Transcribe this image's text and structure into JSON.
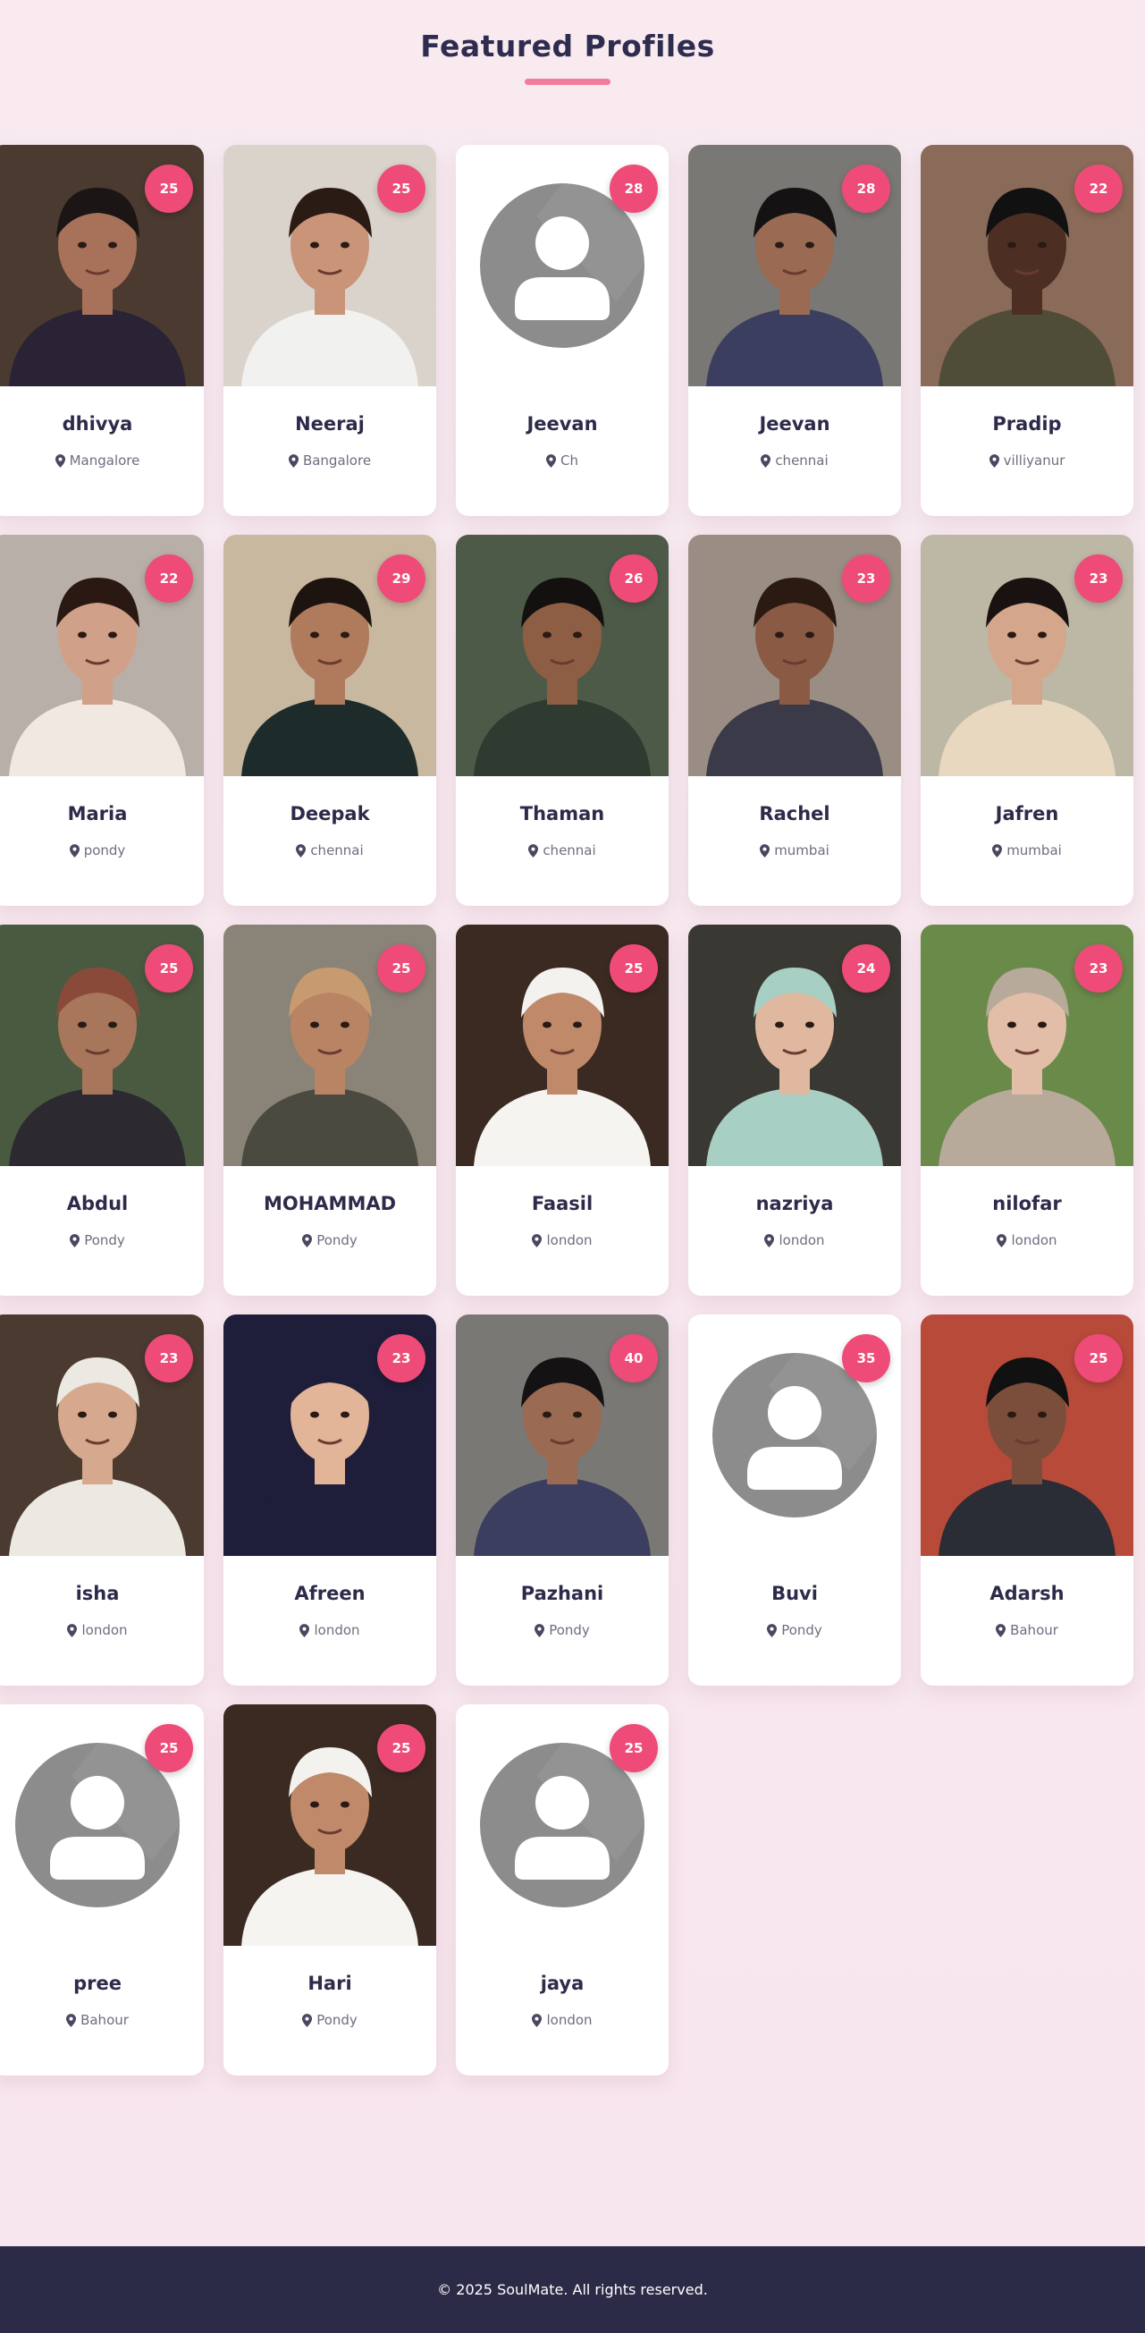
{
  "section_title": "Featured Profiles",
  "footer": {
    "copyright": "© 2025 SoulMate. All rights reserved."
  },
  "profiles": [
    {
      "name": "dhivya",
      "age": "25",
      "location": "Mangalore",
      "photo": "person",
      "skin": "#a8725a",
      "hair": "#1b1515",
      "shirt": "#2a2235",
      "bg": "#4a3a30"
    },
    {
      "name": "Neeraj",
      "age": "25",
      "location": "Bangalore",
      "photo": "person",
      "skin": "#c99478",
      "hair": "#2a1c14",
      "shirt": "#f1f1ef",
      "bg": "#d9d3cb"
    },
    {
      "name": "Jeevan",
      "age": "28",
      "location": "Ch",
      "photo": "placeholder"
    },
    {
      "name": "Jeevan",
      "age": "28",
      "location": "chennai",
      "photo": "person",
      "skin": "#9a6a52",
      "hair": "#141212",
      "shirt": "#3b3e5e",
      "bg": "#7a7874"
    },
    {
      "name": "Pradip",
      "age": "22",
      "location": "villiyanur",
      "photo": "person",
      "skin": "#4c2f22",
      "hair": "#111",
      "shirt": "#4f4d38",
      "bg": "#8a6a58"
    },
    {
      "name": "Maria",
      "age": "22",
      "location": "pondy",
      "photo": "person",
      "skin": "#d1a088",
      "hair": "#2a1812",
      "shirt": "#f2e8e2",
      "bg": "#b8b0a8"
    },
    {
      "name": "Deepak",
      "age": "29",
      "location": "chennai",
      "photo": "person",
      "skin": "#b07a5c",
      "hair": "#1d1410",
      "shirt": "#1e2b2b",
      "bg": "#c8b8a0"
    },
    {
      "name": "Thaman",
      "age": "26",
      "location": "chennai",
      "photo": "person",
      "skin": "#8e5e44",
      "hair": "#141010",
      "shirt": "#2f3a30",
      "bg": "#4e5a48"
    },
    {
      "name": "Rachel",
      "age": "23",
      "location": "mumbai",
      "photo": "person",
      "skin": "#8a5a44",
      "hair": "#2a1a12",
      "shirt": "#3a3a48",
      "bg": "#9a8e84"
    },
    {
      "name": "Jafren",
      "age": "23",
      "location": "mumbai",
      "photo": "person",
      "skin": "#d4a68c",
      "hair": "#1a1210",
      "shirt": "#e8d8c0",
      "bg": "#bdb7a6"
    },
    {
      "name": "Abdul",
      "age": "25",
      "location": "Pondy",
      "photo": "person",
      "skin": "#a8765a",
      "hair": "#8a4a3a",
      "shirt": "#2c2a30",
      "bg": "#4a5a40"
    },
    {
      "name": "MOHAMMAD",
      "age": "25",
      "location": "Pondy",
      "photo": "person",
      "skin": "#b88464",
      "hair": "#c89a70",
      "shirt": "#4a4a40",
      "bg": "#8a8478"
    },
    {
      "name": "Faasil",
      "age": "25",
      "location": "london",
      "photo": "person",
      "skin": "#c08a6a",
      "hair": "#f4f2ee",
      "shirt": "#f6f4f0",
      "bg": "#3a2a22"
    },
    {
      "name": "nazriya",
      "age": "24",
      "location": "london",
      "photo": "person",
      "skin": "#e0b8a0",
      "hair": "#a8cfc4",
      "shirt": "#a8cfc4",
      "bg": "#3a3832"
    },
    {
      "name": "nilofar",
      "age": "23",
      "location": "london",
      "photo": "person",
      "skin": "#e2bea8",
      "hair": "#b8aa9a",
      "shirt": "#b8aa9a",
      "bg": "#6a8a4a"
    },
    {
      "name": "isha",
      "age": "23",
      "location": "london",
      "photo": "person",
      "skin": "#d6a88e",
      "hair": "#ece8e2",
      "shirt": "#ece8e2",
      "bg": "#4a3a30"
    },
    {
      "name": "Afreen",
      "age": "23",
      "location": "london",
      "photo": "person",
      "skin": "#e2b498",
      "hair": "#1e1e3a",
      "shirt": "#1e1e3a",
      "bg": "#1e1e3a"
    },
    {
      "name": "Pazhani",
      "age": "40",
      "location": "Pondy",
      "photo": "person",
      "skin": "#9a6a52",
      "hair": "#141212",
      "shirt": "#3b3e5e",
      "bg": "#7a7874"
    },
    {
      "name": "Buvi",
      "age": "35",
      "location": "Pondy",
      "photo": "placeholder"
    },
    {
      "name": "Adarsh",
      "age": "25",
      "location": "Bahour",
      "photo": "person",
      "skin": "#7a4e3a",
      "hair": "#111",
      "shirt": "#2a2c36",
      "bg": "#b84a3a"
    },
    {
      "name": "pree",
      "age": "25",
      "location": "Bahour",
      "photo": "placeholder"
    },
    {
      "name": "Hari",
      "age": "25",
      "location": "Pondy",
      "photo": "person",
      "skin": "#c08a6a",
      "hair": "#f4f2ee",
      "shirt": "#f6f4f0",
      "bg": "#3a2a22"
    },
    {
      "name": "jaya",
      "age": "25",
      "location": "london",
      "photo": "placeholder"
    }
  ]
}
